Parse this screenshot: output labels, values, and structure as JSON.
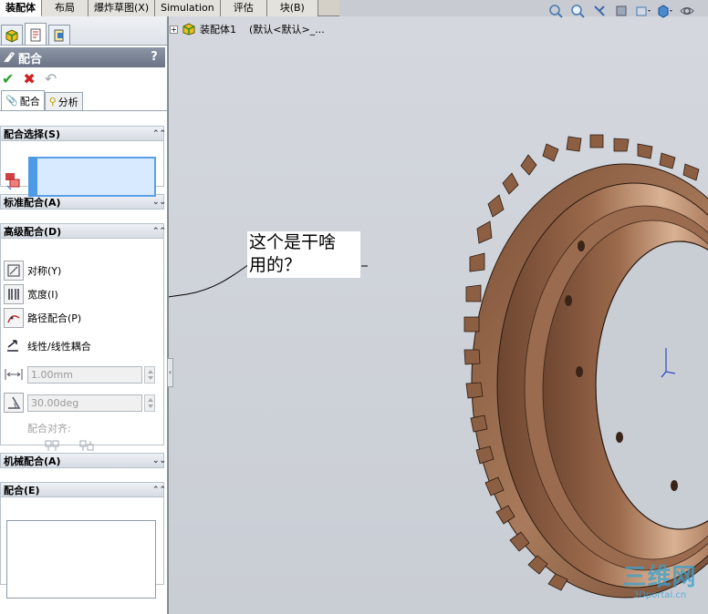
{
  "top_tabs": [
    "装配体",
    "布局",
    "爆炸草图(X)",
    "Simulation",
    "评估",
    "块(B)"
  ],
  "tree": {
    "root_label": "装配体1",
    "config_label": "(默认<默认>_..."
  },
  "property_manager": {
    "title": "配合",
    "help": "?",
    "subtabs": {
      "mates": "配合",
      "analysis": "分析"
    },
    "mate_selections": {
      "heading": "配合选择(S)"
    },
    "standard_mates": {
      "heading": "标准配合(A)"
    },
    "advanced_mates": {
      "heading": "高级配合(D)",
      "symmetric": "对称(Y)",
      "width": "宽度(I)",
      "path": "路径配合(P)",
      "linear_coupler": "线性/线性耦合",
      "distance_value": "1.00mm",
      "angle_value": "30.00deg",
      "alignment_label": "配合对齐:"
    },
    "mechanical_mates": {
      "heading": "机械配合(A)"
    },
    "mates": {
      "heading": "配合(E)"
    }
  },
  "annotation": {
    "line1": "这个是干啥",
    "line2": "用的？"
  },
  "watermark": {
    "brand": "三维网",
    "site": "3Dportal.cn"
  },
  "colors": {
    "gear": "#8a5a3c",
    "gear_light": "#c79a78",
    "selection": "#d8eaff",
    "title_bar": "#7a8496"
  }
}
